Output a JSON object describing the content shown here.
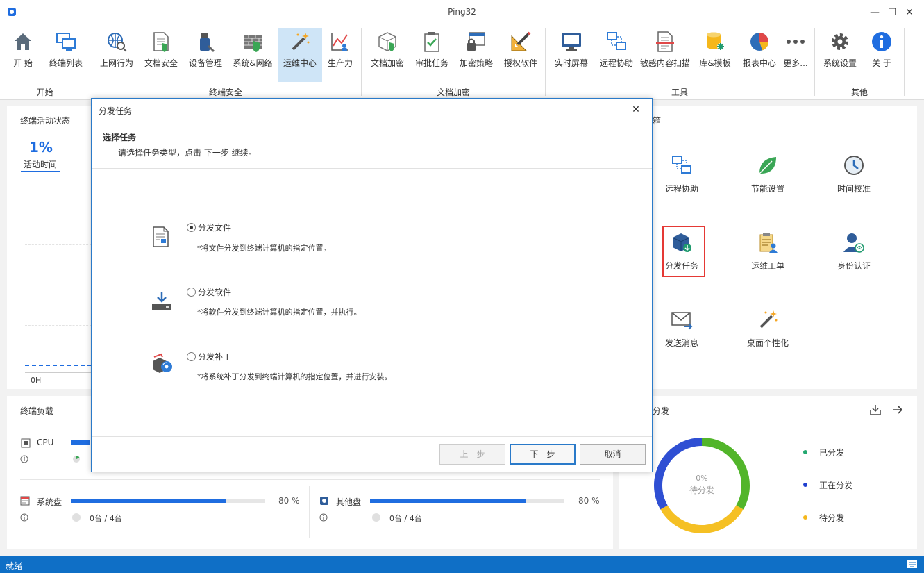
{
  "window": {
    "title": "Ping32",
    "minimize": "—",
    "maximize": "☐",
    "close": "✕"
  },
  "ribbon": {
    "groups": [
      {
        "label": "开始",
        "items": [
          "开 始",
          "终端列表"
        ]
      },
      {
        "label": "终端安全",
        "items": [
          "上网行为",
          "文档安全",
          "设备管理",
          "系统&网络",
          "运维中心",
          "生产力"
        ]
      },
      {
        "label": "文档加密",
        "items": [
          "文档加密",
          "审批任务",
          "加密策略",
          "授权软件"
        ]
      },
      {
        "label": "工具",
        "items": [
          "实时屏幕",
          "远程协助",
          "敏感内容扫描",
          "库&模板",
          "报表中心",
          "更多..."
        ]
      },
      {
        "label": "其他",
        "items": [
          "系统设置",
          "关 于"
        ]
      }
    ],
    "selected": "运维中心"
  },
  "activity": {
    "title": "终端活动状态",
    "percent": "1%",
    "tab": "活动时间",
    "axis_start": "0H"
  },
  "tools": {
    "header_partial": "箱",
    "items": [
      "远程协助",
      "节能设置",
      "时间校准",
      "分发任务",
      "运维工单",
      "身份认证",
      "发送消息",
      "桌面个性化"
    ],
    "highlighted": "分发任务"
  },
  "load": {
    "title": "终端负载",
    "cpu": {
      "label": "CPU",
      "value_fraction": 0.8
    },
    "system_disk": {
      "label": "系统盘",
      "percent": "80 %",
      "value_fraction": 0.8,
      "count": "0台 / 4台"
    },
    "other_disk": {
      "label": "其他盘",
      "percent": "80 %",
      "value_fraction": 0.8,
      "count": "0台 / 4台"
    }
  },
  "dispatch": {
    "title_partial": "分发",
    "center_percent": "0%",
    "center_label": "待分发",
    "legend": [
      {
        "label": "已分发",
        "color": "#23a870"
      },
      {
        "label": "正在分发",
        "color": "#1f3fcf"
      },
      {
        "label": "待分发",
        "color": "#f5b71b"
      }
    ],
    "ring_colors": {
      "green": "#52b52a",
      "blue": "#2f4fd3",
      "yellow": "#f5c024"
    }
  },
  "dialog": {
    "title": "分发任务",
    "heading": "选择任务",
    "subheading": "请选择任务类型，点击 下一步 继续。",
    "options": [
      {
        "title": "分发文件",
        "desc": "*将文件分发到终端计算机的指定位置。",
        "checked": true
      },
      {
        "title": "分发软件",
        "desc": "*将软件分发到终端计算机的指定位置，并执行。",
        "checked": false
      },
      {
        "title": "分发补丁",
        "desc": "*将系统补丁分发到终端计算机的指定位置，并进行安装。",
        "checked": false
      }
    ],
    "buttons": {
      "prev": "上一步",
      "next": "下一步",
      "cancel": "取消"
    },
    "close": "✕"
  },
  "status_bar": {
    "text": "就绪"
  },
  "colors": {
    "accent": "#1f6de0",
    "status_bar": "#0f6fc6",
    "dialog_border": "#2a7ac9",
    "highlight": "#e53935"
  }
}
